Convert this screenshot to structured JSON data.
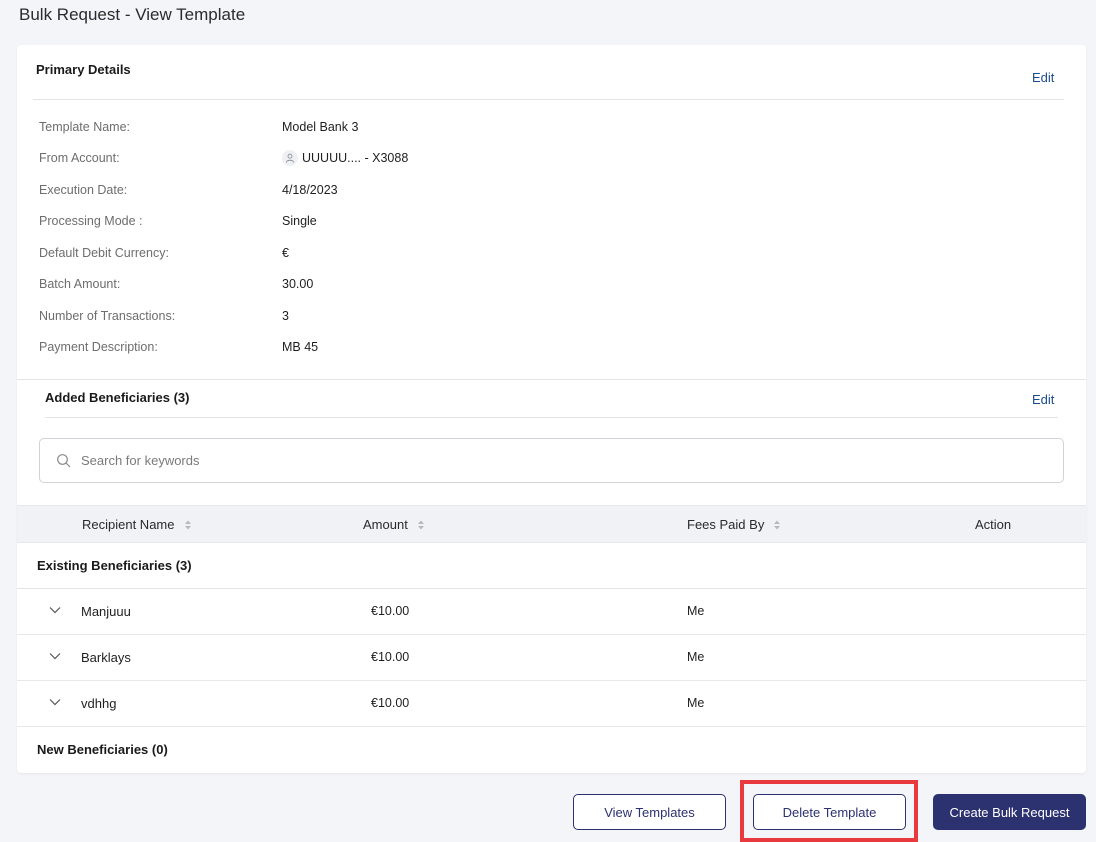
{
  "page": {
    "title": "Bulk Request - View Template"
  },
  "primary_details": {
    "title": "Primary Details",
    "edit_label": "Edit",
    "fields": [
      {
        "label": "Template Name:",
        "value": "Model Bank 3"
      },
      {
        "label": "From Account:",
        "value": "UUUUU.... - X3088",
        "icon": "user-icon"
      },
      {
        "label": "Execution Date:",
        "value": "4/18/2023"
      },
      {
        "label": "Processing Mode :",
        "value": "Single"
      },
      {
        "label": "Default Debit Currency:",
        "value": "€"
      },
      {
        "label": "Batch Amount:",
        "value": "30.00"
      },
      {
        "label": "Number of Transactions:",
        "value": "3"
      },
      {
        "label": "Payment Description:",
        "value": "MB 45"
      }
    ]
  },
  "beneficiaries": {
    "title": "Added Beneficiaries (3)",
    "edit_label": "Edit",
    "search": {
      "placeholder": "Search for keywords",
      "value": ""
    },
    "columns": {
      "recipient_name": "Recipient Name",
      "amount": "Amount",
      "fees_paid_by": "Fees Paid By",
      "action": "Action"
    },
    "existing_title": "Existing Beneficiaries (3)",
    "rows": [
      {
        "name": "Manjuuu",
        "amount": "€10.00",
        "fees": "Me"
      },
      {
        "name": "Barklays",
        "amount": "€10.00",
        "fees": "Me"
      },
      {
        "name": "vdhhg",
        "amount": "€10.00",
        "fees": "Me"
      }
    ],
    "new_title": "New Beneficiaries (0)"
  },
  "footer": {
    "view_templates": "View Templates",
    "delete_template": "Delete Template",
    "create_bulk_request": "Create Bulk Request"
  },
  "colors": {
    "accent": "#2c3170",
    "link": "#1b4d8e",
    "highlight": "#e8393f"
  }
}
